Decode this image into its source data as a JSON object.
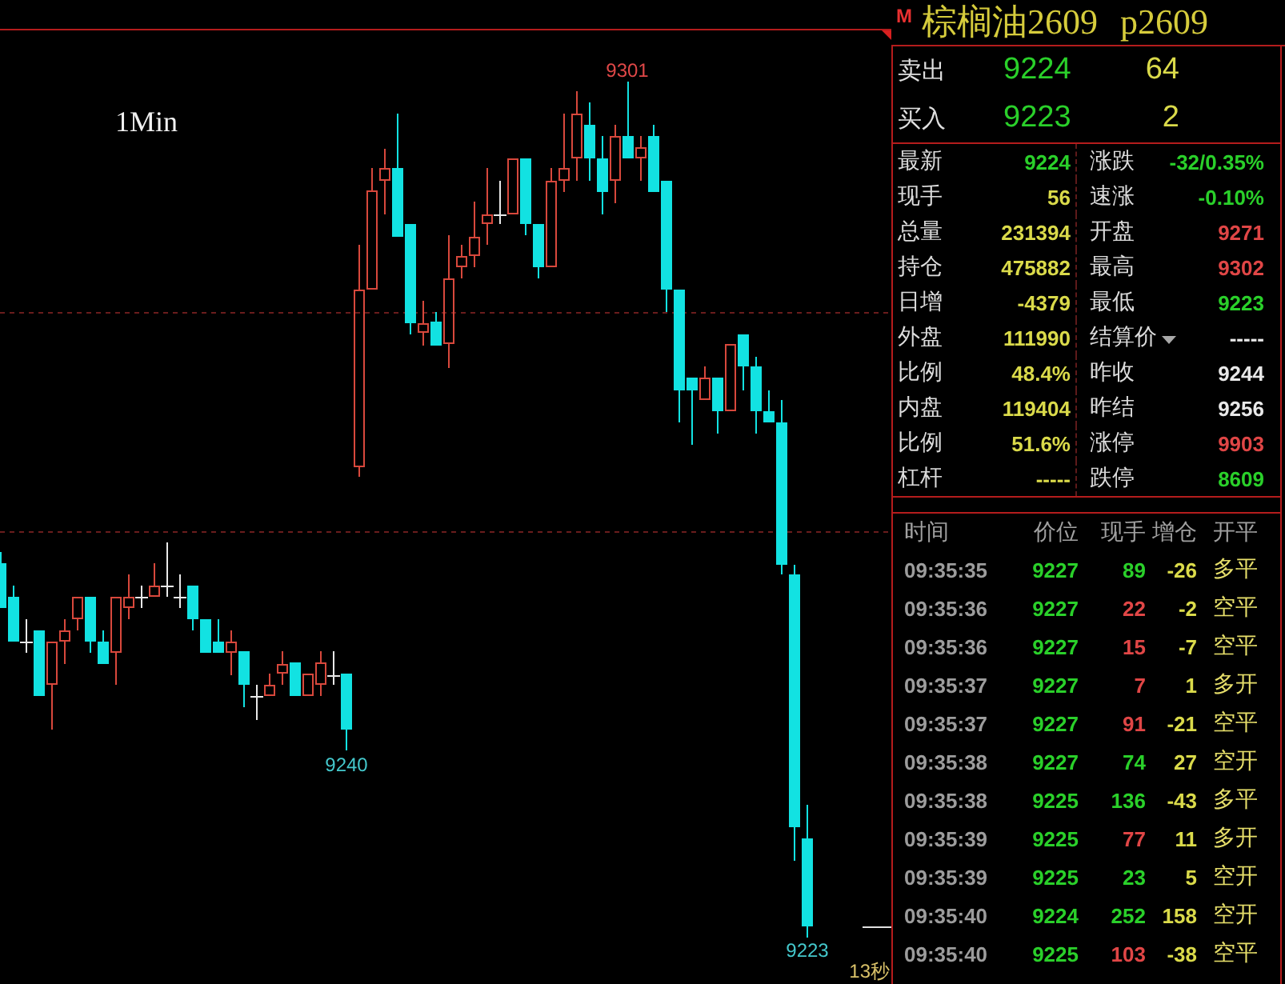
{
  "chart": {
    "period": "1Min",
    "high_label": "9301",
    "low_labels": [
      "9240",
      "9223"
    ],
    "countdown": "13秒"
  },
  "quote": {
    "marker": "M",
    "name": "棕榈油2609",
    "code": "p2609",
    "book": [
      {
        "label": "卖出",
        "price": "9224",
        "volume": "64"
      },
      {
        "label": "买入",
        "price": "9223",
        "volume": "2"
      }
    ]
  },
  "stats": [
    {
      "cells": [
        {
          "label": "最新",
          "value": "9224",
          "color": "#2ad02a",
          "dropdown": false
        },
        {
          "label": "涨跌",
          "value": "-32/0.35%",
          "color": "#2ad02a",
          "dropdown": false
        }
      ]
    },
    {
      "cells": [
        {
          "label": "现手",
          "value": "56",
          "color": "#dada4a",
          "dropdown": false
        },
        {
          "label": "速涨",
          "value": "-0.10%",
          "color": "#2ad02a",
          "dropdown": false
        }
      ]
    },
    {
      "cells": [
        {
          "label": "总量",
          "value": "231394",
          "color": "#dada4a",
          "dropdown": false
        },
        {
          "label": "开盘",
          "value": "9271",
          "color": "#e04646",
          "dropdown": false
        }
      ]
    },
    {
      "cells": [
        {
          "label": "持仓",
          "value": "475882",
          "color": "#dada4a",
          "dropdown": false
        },
        {
          "label": "最高",
          "value": "9302",
          "color": "#e04646",
          "dropdown": false
        }
      ]
    },
    {
      "cells": [
        {
          "label": "日增",
          "value": "-4379",
          "color": "#dada4a",
          "dropdown": false
        },
        {
          "label": "最低",
          "value": "9223",
          "color": "#2ad02a",
          "dropdown": false
        }
      ]
    },
    {
      "cells": [
        {
          "label": "外盘",
          "value": "111990",
          "color": "#dada4a",
          "dropdown": false
        },
        {
          "label": "结算价",
          "value": "-----",
          "color": "#e8e8e8",
          "dropdown": true
        }
      ]
    },
    {
      "cells": [
        {
          "label": "比例",
          "value": "48.4%",
          "color": "#dada4a",
          "dropdown": false
        },
        {
          "label": "昨收",
          "value": "9244",
          "color": "#e8e8e8",
          "dropdown": false
        }
      ]
    },
    {
      "cells": [
        {
          "label": "内盘",
          "value": "119404",
          "color": "#dada4a",
          "dropdown": false
        },
        {
          "label": "昨结",
          "value": "9256",
          "color": "#e8e8e8",
          "dropdown": false
        }
      ]
    },
    {
      "cells": [
        {
          "label": "比例",
          "value": "51.6%",
          "color": "#dada4a",
          "dropdown": false
        },
        {
          "label": "涨停",
          "value": "9903",
          "color": "#e04646",
          "dropdown": false
        }
      ]
    },
    {
      "cells": [
        {
          "label": "杠杆",
          "value": "-----",
          "color": "#dada4a",
          "dropdown": false
        },
        {
          "label": "跌停",
          "value": "8609",
          "color": "#2ad02a",
          "dropdown": false
        }
      ]
    }
  ],
  "trades": {
    "columns": [
      "时间",
      "价位",
      "现手",
      "增仓",
      "开平"
    ],
    "rows": [
      {
        "time": "09:35:35",
        "price": "9227",
        "volume": {
          "value": "89",
          "color": "#2ad02a"
        },
        "change": "-26",
        "type": "多平"
      },
      {
        "time": "09:35:36",
        "price": "9227",
        "volume": {
          "value": "22",
          "color": "#e04646"
        },
        "change": "-2",
        "type": "空平"
      },
      {
        "time": "09:35:36",
        "price": "9227",
        "volume": {
          "value": "15",
          "color": "#e04646"
        },
        "change": "-7",
        "type": "空平"
      },
      {
        "time": "09:35:37",
        "price": "9227",
        "volume": {
          "value": "7",
          "color": "#e04646"
        },
        "change": "1",
        "type": "多开"
      },
      {
        "time": "09:35:37",
        "price": "9227",
        "volume": {
          "value": "91",
          "color": "#e04646"
        },
        "change": "-21",
        "type": "空平"
      },
      {
        "time": "09:35:38",
        "price": "9227",
        "volume": {
          "value": "74",
          "color": "#2ad02a"
        },
        "change": "27",
        "type": "空开"
      },
      {
        "time": "09:35:38",
        "price": "9225",
        "volume": {
          "value": "136",
          "color": "#2ad02a"
        },
        "change": "-43",
        "type": "多平"
      },
      {
        "time": "09:35:39",
        "price": "9225",
        "volume": {
          "value": "77",
          "color": "#e04646"
        },
        "change": "11",
        "type": "多开"
      },
      {
        "time": "09:35:39",
        "price": "9225",
        "volume": {
          "value": "23",
          "color": "#2ad02a"
        },
        "change": "5",
        "type": "空开"
      },
      {
        "time": "09:35:40",
        "price": "9224",
        "volume": {
          "value": "252",
          "color": "#2ad02a"
        },
        "change": "158",
        "type": "空开"
      },
      {
        "time": "09:35:40",
        "price": "9225",
        "volume": {
          "value": "103",
          "color": "#e04646"
        },
        "change": "-38",
        "type": "空平"
      }
    ]
  }
}
